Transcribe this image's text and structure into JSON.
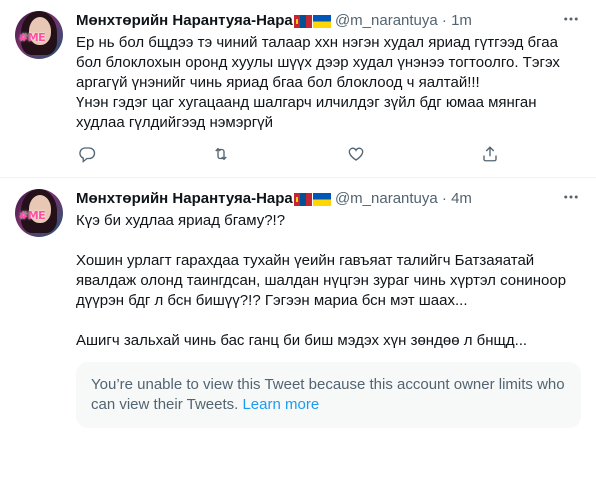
{
  "colors": {
    "link": "#1d9bf0",
    "muted": "#536471",
    "text": "#0f1419"
  },
  "tweets": [
    {
      "name": "Мөнхтөрийн Нарантуяа-Нара",
      "handle": "@m_narantuya",
      "separator": "·",
      "time": "1m",
      "text": "Ер нь бол бщдээ тэ чиний талаар ххн нэгэн худал яриад гүтгээд бгаа бол блоклохын оронд хуулы шүүх дээр худал үнэнээ тогтоолго. Тэгэх аргагүй үнэнийг чинь яриад бгаа бол блоклоод ч яалтай!!!\nҮнэн гэдэг цаг хугацаанд шалгарч илчилдэг зүйл бдг юмаа мянган худлаа гүлдийгээд нэмэргүй",
      "icons": [
        "avatar",
        "mongolia-flag-icon",
        "ukraine-flag-icon",
        "more-icon",
        "reply-icon",
        "retweet-icon",
        "like-icon",
        "share-icon"
      ]
    },
    {
      "name": "Мөнхтөрийн Нарантуяа-Нара",
      "handle": "@m_narantuya",
      "separator": "·",
      "time": "4m",
      "text": "Күэ би худлаа яриад бгаму?!?\n\nХошин урлагт гарахдаа тухайн үеийн гавъяат талийгч Батзаяатай явалдаж олонд таингдсан, шалдан нүцгэн зураг чинь хүртэл сониноор дүүрэн бдг л бсн бишүү?!? Гэгээн мариа бсн мэт шаах...\n\nАшигч зальхай чинь бас ганц би биш мэдэх хүн зөндөө л бнщд...",
      "restricted_text": "You’re unable to view this Tweet because this account owner limits who can view their Tweets.",
      "restricted_link": "Learn more"
    }
  ]
}
